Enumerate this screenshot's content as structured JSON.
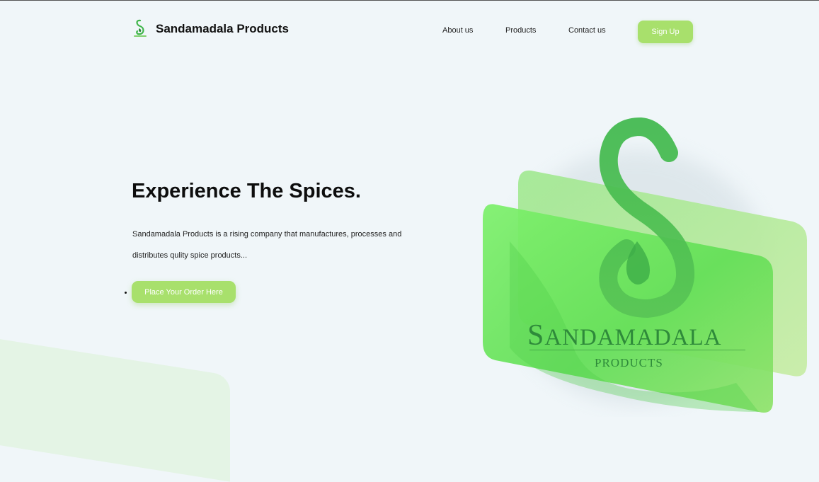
{
  "brand": {
    "name": "Sandamadala Products",
    "logo_icon": "swan-s-logo-icon"
  },
  "nav": {
    "items": [
      {
        "label": "About us"
      },
      {
        "label": "Products"
      },
      {
        "label": "Contact us"
      }
    ],
    "signup_label": "Sign Up"
  },
  "hero": {
    "title": "Experience The Spices.",
    "description": "Sandamadala Products is a rising company that manufactures, processes and distributes qulity spice products...",
    "order_button_label": "Place Your Order Here"
  },
  "hero_logo": {
    "word_initial": "S",
    "word_rest": "ANDAMADALA",
    "subword": "PRODUCTS"
  },
  "colors": {
    "background": "#f0f6f9",
    "accent_button": "#a8e06c",
    "logo_green": "#2e8a3a",
    "card_green": "#6fe060"
  }
}
